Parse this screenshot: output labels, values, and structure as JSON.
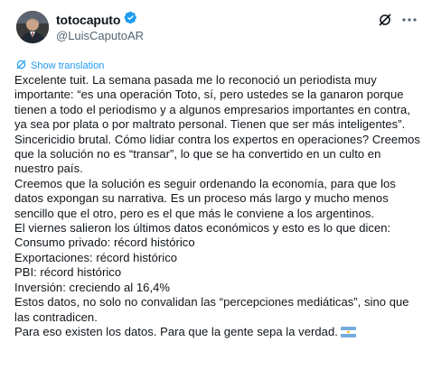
{
  "author": {
    "display_name": "totocaputo",
    "handle": "@LuisCaputoAR",
    "verified": true
  },
  "header": {
    "icons": [
      "verified-badge-icon",
      "grok-icon",
      "more-icon"
    ]
  },
  "translate": {
    "label": "Show translation"
  },
  "tweet": {
    "paragraphs": [
      "Excelente tuit. La semana pasada me lo reconoció un periodista muy importante: “es una operación Toto, sí, pero ustedes se la ganaron porque tienen a todo el periodismo y a algunos empresarios importantes en contra, ya sea por plata o por maltrato personal. Tienen que ser más inteligentes”. Sincericidio brutal. Cómo lidiar contra los expertos en operaciones? Creemos que la solución no es “transar”,  lo que se ha convertido en un culto en nuestro país.",
      "Creemos que la solución es seguir ordenando la economía, para que los datos expongan su narrativa. Es un proceso más largo y mucho menos sencillo que el otro, pero es el que más le conviene a los argentinos.",
      "El viernes salieron los últimos datos económicos y esto es lo que dicen:",
      "Consumo privado: récord histórico",
      "Exportaciones: récord histórico",
      "PBI: récord histórico",
      "Inversión: creciendo al 16,4%",
      "Estos datos, no solo no convalidan las “percepciones mediáticas”, sino que las contradicen.",
      "Para eso existen los datos. Para que la gente sepa la verdad."
    ],
    "trailing_emoji": "argentina-flag-icon"
  },
  "colors": {
    "text": "#0f1419",
    "secondary": "#536471",
    "accent": "#1d9bf0",
    "flag_blue": "#74acdf",
    "flag_sun": "#f6b40e"
  }
}
